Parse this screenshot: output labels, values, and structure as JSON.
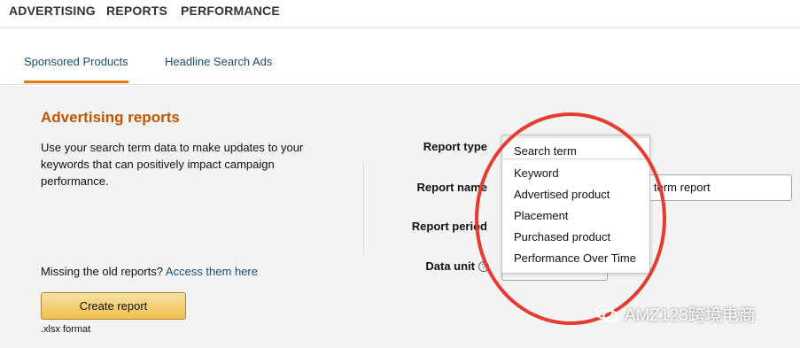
{
  "topnav": {
    "items": [
      "ADVERTISING",
      "REPORTS",
      "PERFORMANCE"
    ]
  },
  "tabs": [
    "Sponsored Products",
    "Headline Search Ads"
  ],
  "intro": {
    "title": "Advertising reports",
    "description": "Use your search term data to make updates to your keywords that can positively impact campaign performance.",
    "missing_text": "Missing the old reports?",
    "missing_link": "Access them here",
    "create_button": "Create report",
    "format_note": ".xlsx format"
  },
  "form": {
    "report_type_label": "Report type",
    "report_name_label": "Report name",
    "report_period_label": "Report period",
    "data_unit_label": "Data unit",
    "report_name_value": "term report",
    "report_type_selected": "Search term",
    "report_type_options": [
      "Keyword",
      "Advertised product",
      "Placement",
      "Purchased product",
      "Performance Over Time"
    ]
  },
  "watermark": {
    "text": "AMZ123跨境电商"
  },
  "colors": {
    "accent": "#c45500",
    "tab_underline": "#e47911",
    "link": "#1c4c74",
    "annotation_circle": "#e63c30",
    "button": "#f0c14b"
  }
}
